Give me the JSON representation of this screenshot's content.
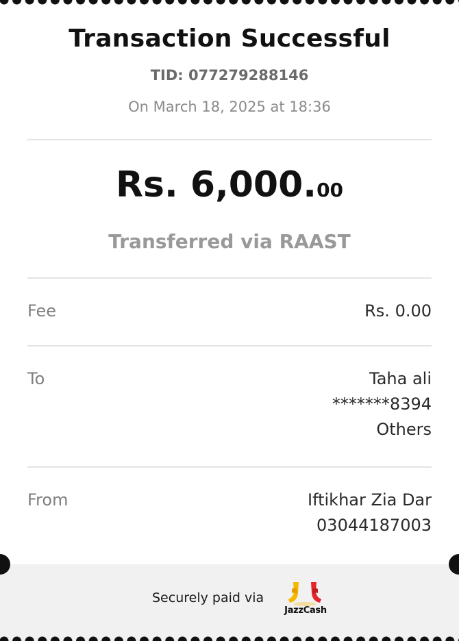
{
  "receipt": {
    "title": "Transaction Successful",
    "tid": "TID: 077279288146",
    "datetime": "On March 18, 2025 at 18:36",
    "amount_main": "Rs. 6,000.",
    "amount_cents": "00",
    "via": "Transferred via RAAST",
    "fee": {
      "label": "Fee",
      "value": "Rs. 0.00"
    },
    "to": {
      "label": "To",
      "name": "Taha ali",
      "account": "*******8394",
      "bank": "Others"
    },
    "from": {
      "label": "From",
      "name": "Iftikhar Zia Dar",
      "number": "03044187003"
    }
  },
  "footer": {
    "secure_text": "Securely paid via",
    "logo_text": "JazzCash",
    "logo_icon": "jazzcash-logo-icon"
  },
  "colors": {
    "title": "#111111",
    "muted": "#8a8a8a",
    "via": "#999999",
    "logo_yellow": "#f5b800",
    "logo_red": "#e5262c"
  }
}
